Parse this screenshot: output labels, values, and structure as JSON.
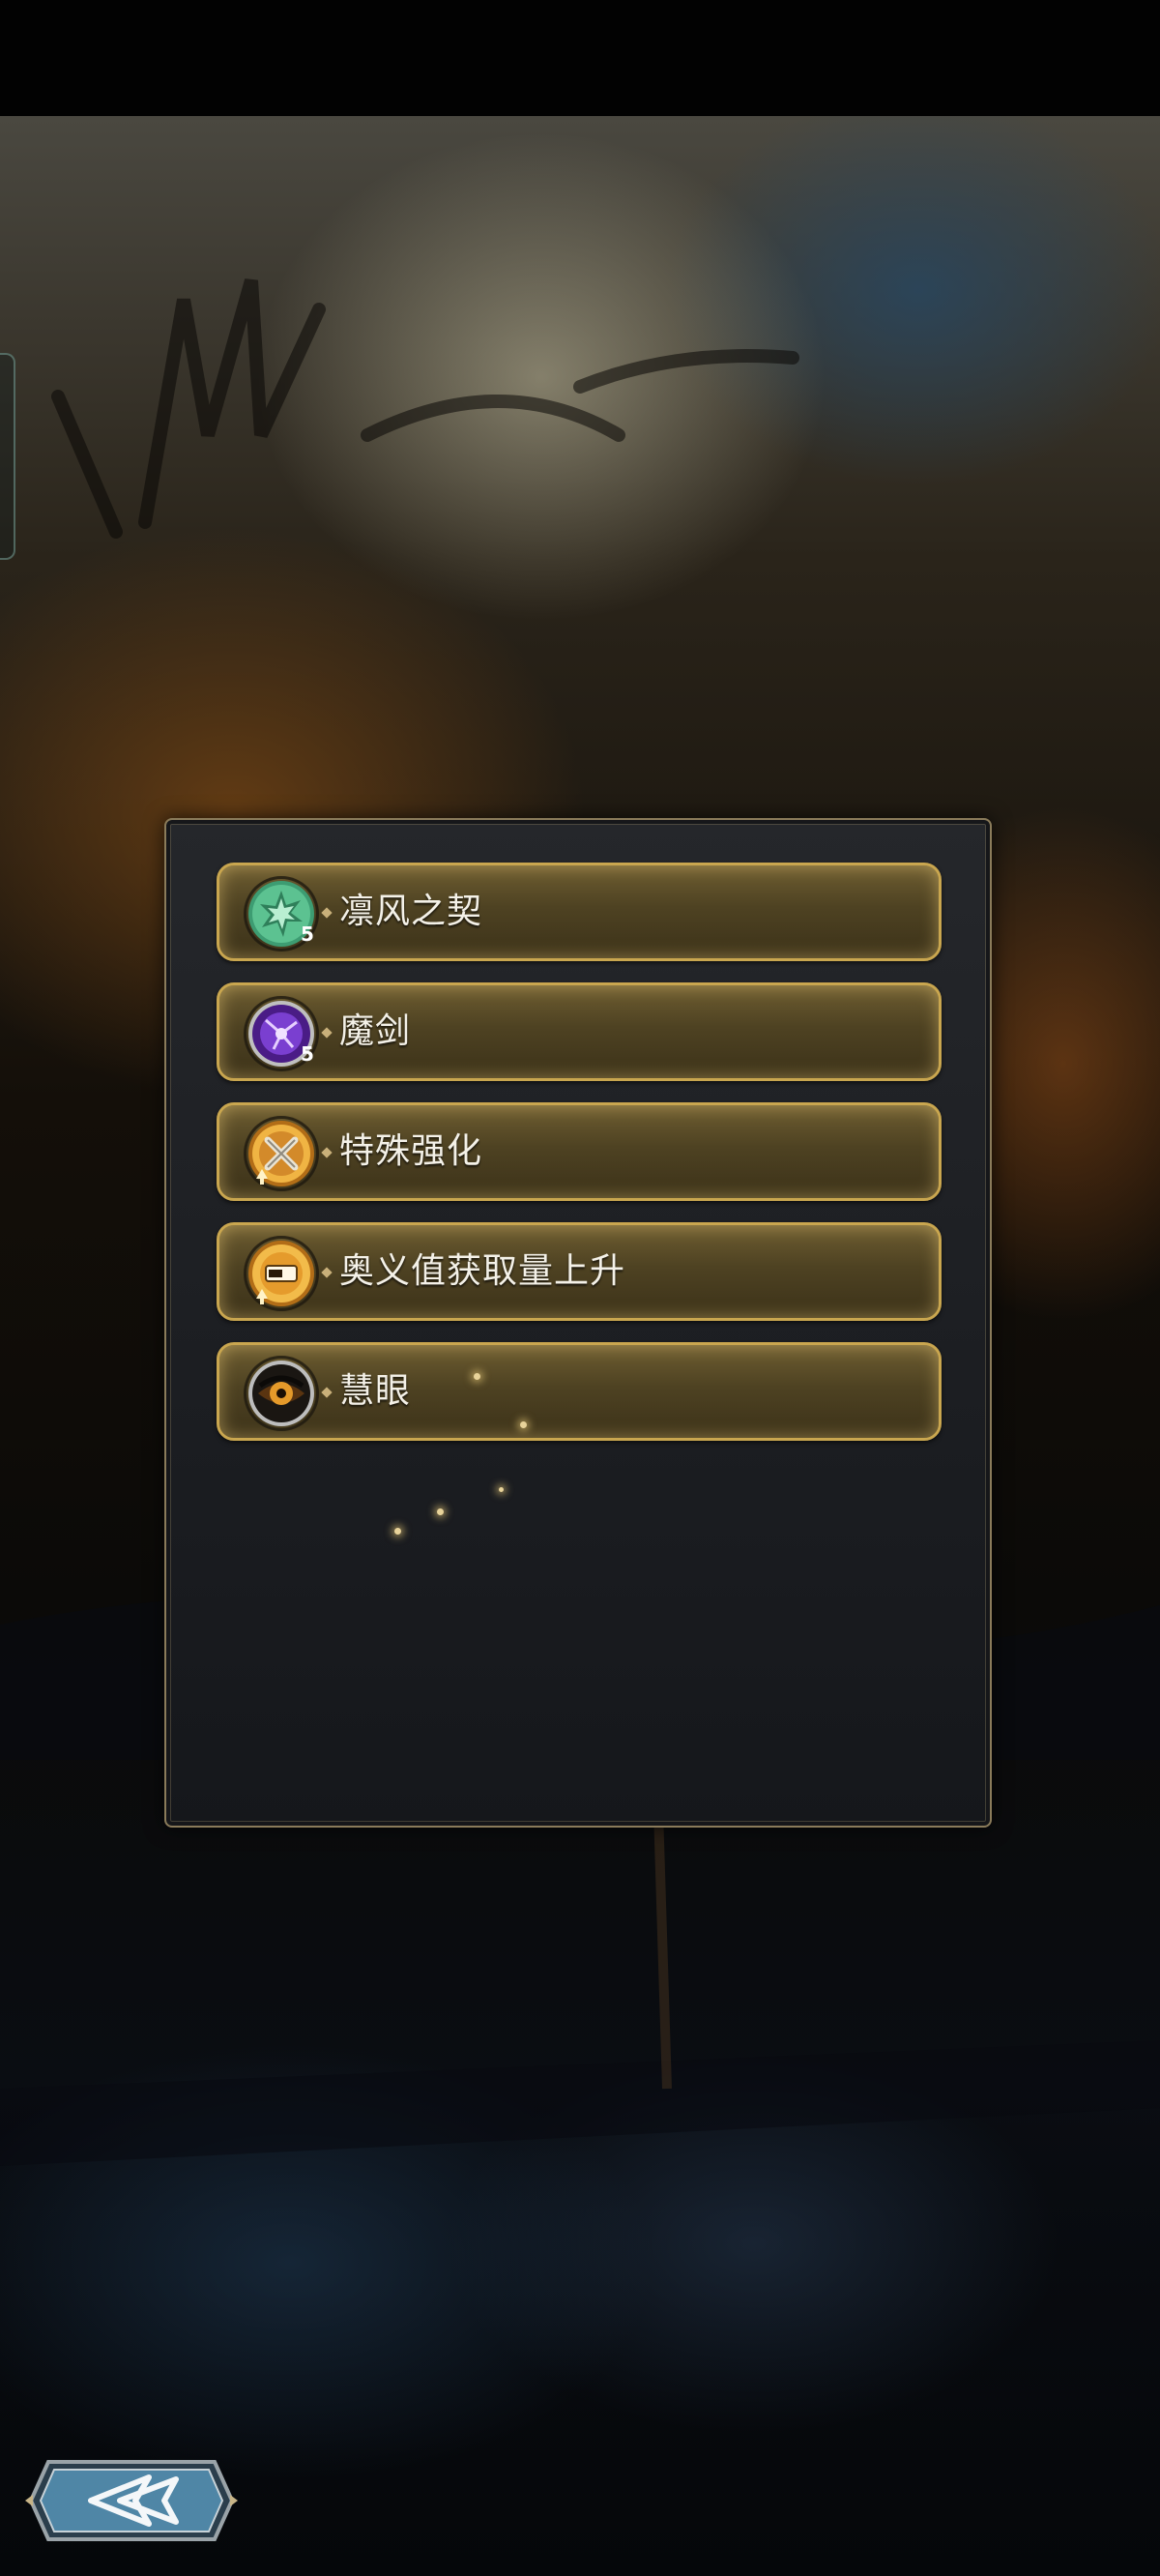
{
  "skills": [
    {
      "name": "凛风之契",
      "icon": "wind-pact-icon",
      "color": "#4cae83"
    },
    {
      "name": "魔剑",
      "icon": "demon-sword-icon",
      "color": "#7c3fc1"
    },
    {
      "name": "特殊强化",
      "icon": "special-enhance-icon",
      "color": "#e3a53a"
    },
    {
      "name": "奥义值获取量上升",
      "icon": "ougi-gain-up-icon",
      "color": "#e3a53a"
    },
    {
      "name": "慧眼",
      "icon": "insight-eye-icon",
      "color": "#c98a2e"
    }
  ],
  "navigation": {
    "back_icon": "back-arrow-icon"
  }
}
